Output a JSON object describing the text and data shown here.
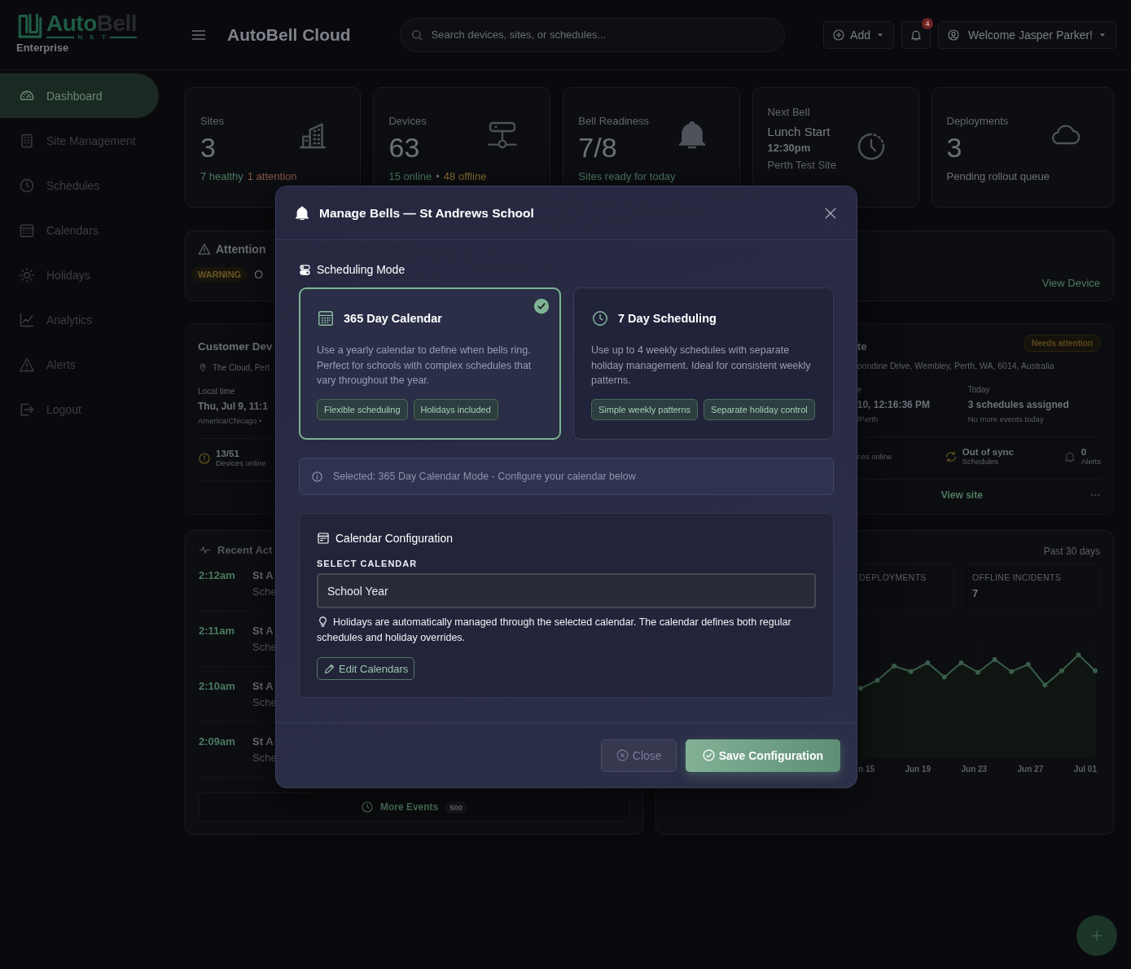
{
  "brand": {
    "logo_word_1": "Auto",
    "logo_word_2": "Bell",
    "logo_tagline": "NET",
    "edition": "Enterprise"
  },
  "sidebar": {
    "items": [
      {
        "label": "Dashboard",
        "selected": true
      },
      {
        "label": "Site Management",
        "selected": false
      },
      {
        "label": "Schedules",
        "selected": false
      },
      {
        "label": "Calendars",
        "selected": false
      },
      {
        "label": "Holidays",
        "selected": false
      },
      {
        "label": "Analytics",
        "selected": false
      },
      {
        "label": "Alerts",
        "selected": false
      },
      {
        "label": "Logout",
        "selected": false
      }
    ]
  },
  "topbar": {
    "title": "AutoBell Cloud",
    "search": {
      "placeholder": "Search devices, sites, or schedules..."
    },
    "add_button": "Add",
    "notification_badge": "4",
    "user_menu": "Welcome Jasper Parker!"
  },
  "stats": [
    {
      "kind": "metric",
      "label": "Sites",
      "value": "3",
      "notes": [
        {
          "text": "7 healthy",
          "color": "#4a7a60"
        },
        {
          "text": "1 attention",
          "color": "#8a5a48"
        }
      ]
    },
    {
      "kind": "metric",
      "label": "Devices",
      "value": "63",
      "notes": [
        {
          "text": "15 online",
          "color": "#4a7a60"
        },
        {
          "text": "•",
          "color": "#6d7078"
        },
        {
          "text": "48 offline",
          "color": "#877030"
        }
      ]
    },
    {
      "kind": "metric",
      "label": "Bell Readiness",
      "value": "7/8",
      "notes": [
        {
          "text": "Sites ready for today",
          "color": "#4a7a60"
        }
      ]
    },
    {
      "kind": "next",
      "label": "Next Bell",
      "name": "Lunch Start",
      "time": "12:30pm",
      "site": "Perth Test Site"
    },
    {
      "kind": "metric",
      "label": "Deployments",
      "value": "3",
      "notes": [
        {
          "text": "Pending rollout queue",
          "color": "#6d7078"
        }
      ]
    }
  ],
  "attention": {
    "title": "Attention",
    "badge": "WARNING",
    "message": "O",
    "link": "View Device"
  },
  "site_card_left": {
    "title": "Customer Dev",
    "location": "The Cloud, Pert",
    "time_label": "Local time",
    "time": "Thu, Jul 9, 11:1",
    "timezone": "America/Chicago •",
    "devices": "13/51",
    "devices_label": "Devices online"
  },
  "site_card_right": {
    "title": "te",
    "badge": "Needs attention",
    "address": "oondine Drive, Wembley, Perth, WA, 6014, Australia",
    "time_label": "e",
    "time": "10, 12:16:36 PM",
    "timezone": "/Perth",
    "today_label": "Today",
    "today": "3 schedules assigned",
    "today_note": "No more events today",
    "devices_label": "ces online",
    "sync": "Out of sync",
    "sync_label": "Schedules",
    "alerts": "0",
    "alerts_label": "Alerts",
    "link": "View site"
  },
  "recent_activity": {
    "title": "Recent Act",
    "rows": [
      {
        "time": "2:12am",
        "site": "St A",
        "detail": "Sche"
      },
      {
        "time": "2:11am",
        "site": "St A",
        "detail": "Sche"
      },
      {
        "time": "2:10am",
        "site": "St A",
        "detail": "Sche"
      },
      {
        "time": "2:09am",
        "site": "St A",
        "detail": "Sche"
      }
    ],
    "more_button": {
      "label": "More Events",
      "count": "500"
    }
  },
  "trend_panel": {
    "period": "Past 30 days",
    "tiles": [
      {
        "label": "DEPLOYMENTS"
      },
      {
        "label": "OFFLINE INCIDENTS",
        "value": "7"
      }
    ],
    "x_labels": [
      "n 15",
      "Jun 19",
      "Jun 23",
      "Jun 27",
      "Jul 01"
    ]
  },
  "modal": {
    "title": "Manage Bells — St Andrews School",
    "section_title": "Scheduling Mode",
    "modes": [
      {
        "title": "365 Day Calendar",
        "description": "Use a yearly calendar to define when bells ring. Perfect for schools with complex schedules that vary throughout the year.",
        "tags": [
          "Flexible scheduling",
          "Holidays included"
        ],
        "selected": true
      },
      {
        "title": "7 Day Scheduling",
        "description": "Use up to 4 weekly schedules with separate holiday management. Ideal for consistent weekly patterns.",
        "tags": [
          "Simple weekly patterns",
          "Separate holiday control"
        ],
        "selected": false
      }
    ],
    "info": "Selected: 365 Day Calendar Mode - Configure your calendar below",
    "config": {
      "title": "Calendar Configuration",
      "field_label": "SELECT CALENDAR",
      "select_value": "School Year",
      "hint": "Holidays are automatically managed through the selected calendar. The calendar defines both regular schedules and holiday overrides.",
      "edit_button": "Edit Calendars"
    },
    "buttons": {
      "close": "Close",
      "save": "Save Configuration"
    }
  }
}
